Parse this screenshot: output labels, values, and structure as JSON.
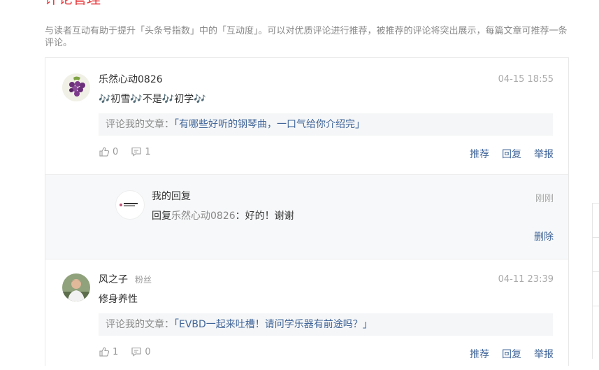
{
  "header": {
    "title_cut": "评论管理",
    "description": "与读者互动有助于提升「头条号指数」中的「互动度」。可以对优质评论进行推荐，被推荐的评论将突出展示，每篇文章可推荐一条评论。"
  },
  "colors": {
    "accent": "#e8373a",
    "link": "#406599",
    "muted": "#999999",
    "ref_bg": "#f5f6f7"
  },
  "comments": [
    {
      "username": "乐然心动0826",
      "time": "04-15 18:55",
      "text": "🎶初雪🎶不是🎶初学🎶",
      "ref_prefix": "评论我的文章：",
      "ref_title": "「有哪些好听的钢琴曲，一口气给你介绍完」",
      "likes": "0",
      "replies": "1",
      "actions": {
        "recommend": "推荐",
        "reply": "回复",
        "report": "举报"
      },
      "reply": {
        "author": "我的回复",
        "time": "刚刚",
        "reply_to_prefix": "回复",
        "reply_to_user": "乐然心动0826",
        "separator": "：",
        "text": "好的！谢谢",
        "delete": "删除"
      }
    },
    {
      "username": "风之子",
      "badge": "粉丝",
      "time": "04-11 23:39",
      "text": "修身养性",
      "ref_prefix": "评论我的文章：",
      "ref_title": "「EVBD一起来吐槽！请问学乐器有前途吗？」",
      "likes": "1",
      "replies": "0",
      "actions": {
        "recommend": "推荐",
        "reply": "回复",
        "report": "举报"
      }
    }
  ]
}
